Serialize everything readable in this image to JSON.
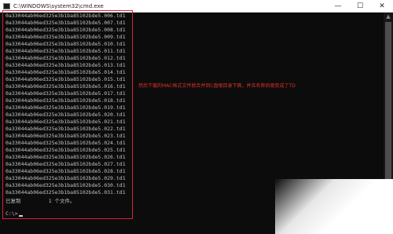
{
  "window": {
    "title": "C:\\WINDOWS\\system32\\cmd.exe",
    "controls": {
      "minimize": "—",
      "maximize": "☐",
      "close": "✕"
    }
  },
  "console": {
    "lines": [
      "0a33044ab06ed325e3b1ba85102bde5.006.td1",
      "0a33044ab06ed325e3b1ba85102bde5.007.td1",
      "0a33044ab06ed325e3b1ba85102bde5.008.td1",
      "0a33044ab06ed325e3b1ba85102bde5.009.td1",
      "0a33044ab06ed325e3b1ba85102bde5.010.td1",
      "0a33044ab06ed325e3b1ba85102bde5.011.td1",
      "0a33044ab06ed325e3b1ba85102bde5.012.td1",
      "0a33044ab06ed325e3b1ba85102bde5.013.td1",
      "0a33044ab06ed325e3b1ba85102bde5.014.td1",
      "0a33044ab06ed325e3b1ba85102bde5.015.td1",
      "0a33044ab06ed325e3b1ba85102bde5.016.td1",
      "0a33044ab06ed325e3b1ba85102bde5.017.td1",
      "0a33044ab06ed325e3b1ba85102bde5.018.td1",
      "0a33044ab06ed325e3b1ba85102bde5.019.td1",
      "0a33044ab06ed325e3b1ba85102bde5.020.td1",
      "0a33044ab06ed325e3b1ba85102bde5.021.td1",
      "0a33044ab06ed325e3b1ba85102bde5.022.td1",
      "0a33044ab06ed325e3b1ba85102bde5.023.td1",
      "0a33044ab06ed325e3b1ba85102bde5.024.td1",
      "0a33044ab06ed325e3b1ba85102bde5.025.td1",
      "0a33044ab06ed325e3b1ba85102bde5.026.td1",
      "0a33044ab06ed325e3b1ba85102bde5.027.td1",
      "0a33044ab06ed325e3b1ba85102bde5.028.td1",
      "0a33044ab06ed325e3b1ba85102bde5.029.td1",
      "0a33044ab06ed325e3b1ba85102bde5.030.td1",
      "0a33044ab06ed325e3b1ba85102bde5.031.td1"
    ],
    "status_line": "已复制         1 个文件。",
    "prompt": "C:\\>"
  },
  "annotation": "然后下载的MAC格式文件就合并到C盘根目录下面，并且名称后缀变成了TD",
  "colors": {
    "highlight": "#d9203a",
    "annotation": "#e0302c",
    "console_bg": "#0c0c0c",
    "console_text": "#c0c0c0"
  }
}
